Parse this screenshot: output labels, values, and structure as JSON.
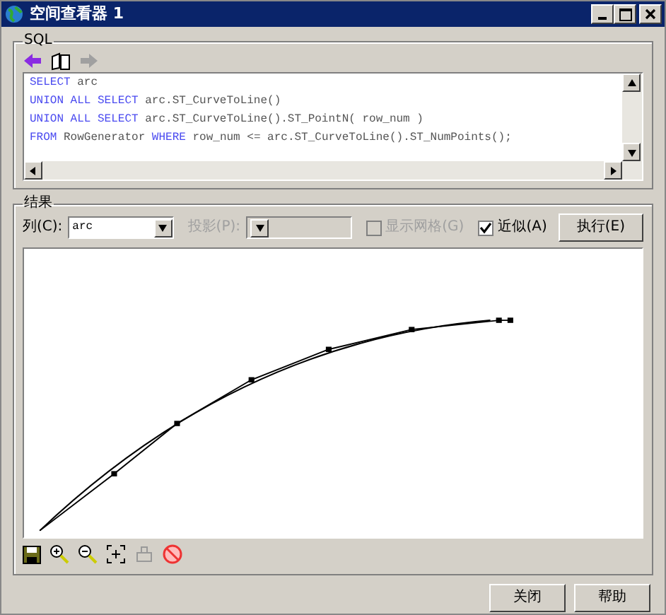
{
  "window": {
    "title": "空间查看器 1"
  },
  "sql": {
    "title": "SQL",
    "lines": [
      [
        {
          "text": "SELECT",
          "kind": "keyword"
        },
        {
          "text": " arc",
          "kind": "plain"
        }
      ],
      [
        {
          "text": "UNION ALL SELECT",
          "kind": "keyword"
        },
        {
          "text": " arc.ST_CurveToLine()",
          "kind": "plain"
        }
      ],
      [
        {
          "text": "UNION ALL SELECT",
          "kind": "keyword"
        },
        {
          "text": " arc.ST_CurveToLine().ST_PointN( row_num )",
          "kind": "plain"
        }
      ],
      [
        {
          "text": "FROM",
          "kind": "keyword"
        },
        {
          "text": " RowGenerator ",
          "kind": "plain"
        },
        {
          "text": "WHERE",
          "kind": "keyword"
        },
        {
          "text": " row_num <= arc.ST_CurveToLine().ST_NumPoints();",
          "kind": "plain"
        }
      ]
    ]
  },
  "results": {
    "title": "结果",
    "column_label": "列(C):",
    "column_value": "arc",
    "projection_label": "投影(P):",
    "projection_disabled": true,
    "show_grid": {
      "label": "显示网格(G)",
      "checked": false,
      "disabled": true
    },
    "approximate": {
      "label": "近似(A)",
      "checked": true
    },
    "execute_button": "执行(E)"
  },
  "buttons": [
    "关闭",
    "帮助"
  ]
}
